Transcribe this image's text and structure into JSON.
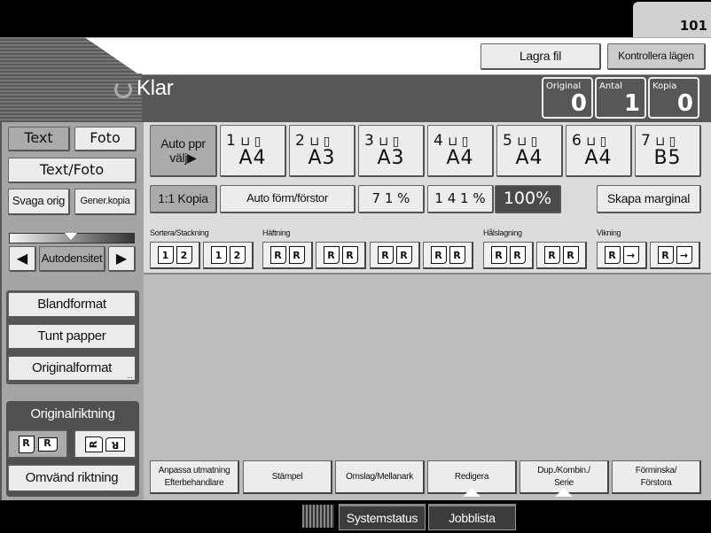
{
  "tab": {
    "label": "101"
  },
  "header": {
    "store_file": "Lagra fil",
    "check_modes": "Kontrollera lägen"
  },
  "status": {
    "text": "Klar",
    "counters": [
      {
        "label": "Original",
        "value": "0"
      },
      {
        "label": "Antal",
        "value": "1"
      },
      {
        "label": "Kopia",
        "value": "0"
      }
    ]
  },
  "original_type": {
    "text": "Text",
    "photo": "Foto",
    "text_photo": "Text/Foto",
    "pale": "Svaga orig",
    "generation": "Gener.kopia",
    "selected": "Text"
  },
  "density": {
    "label": "Autodensitet",
    "level_fraction": 0.5
  },
  "original_options": {
    "mixed": "Blandformat",
    "thin": "Tunt papper",
    "format": "Originalformat",
    "more": "..."
  },
  "orientation": {
    "title": "Originalriktning",
    "reverse": "Omvänd riktning"
  },
  "paper": {
    "auto": "Auto ppr välj▶",
    "trays": [
      {
        "n": "1",
        "size": "A4"
      },
      {
        "n": "2",
        "size": "A3"
      },
      {
        "n": "3",
        "size": "A3"
      },
      {
        "n": "4",
        "size": "A4"
      },
      {
        "n": "5",
        "size": "A4"
      },
      {
        "n": "6",
        "size": "A4"
      },
      {
        "n": "7",
        "size": "B5"
      }
    ]
  },
  "ratio": {
    "full": "1:1 Kopia",
    "auto": "Auto förm/förstor",
    "r71": "7 1 %",
    "r141": "1 4 1 %",
    "r100": "100%",
    "margin": "Skapa marginal"
  },
  "finishing": {
    "sort": "Sortera/Stackning",
    "staple": "Häftning",
    "punch": "Hålslagning",
    "fold": "Vikning"
  },
  "bottom_tabs": [
    {
      "l1": "Anpassa utmatning",
      "l2": "Efterbehandlare"
    },
    {
      "l1": "Stämpel",
      "l2": ""
    },
    {
      "l1": "Omslag/Mellanark",
      "l2": ""
    },
    {
      "l1": "Redigera",
      "l2": ""
    },
    {
      "l1": "Dup./Kombin./",
      "l2": "Serie"
    },
    {
      "l1": "Förminska/",
      "l2": "Förstora"
    }
  ],
  "footer": {
    "system_status": "Systemstatus",
    "job_list": "Jobblista"
  }
}
